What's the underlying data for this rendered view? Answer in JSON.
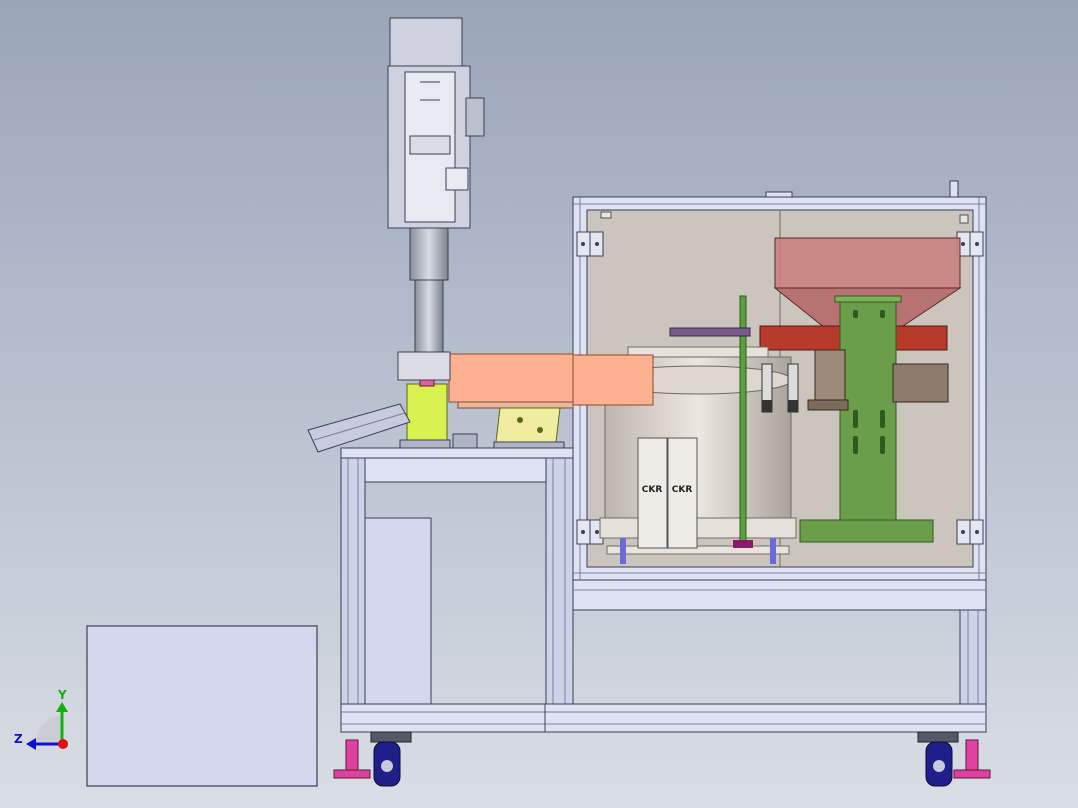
{
  "triad": {
    "y_label": "Y",
    "z_label": "Z",
    "colors": {
      "x": "#e01010",
      "y": "#10b010",
      "z": "#1010d0"
    }
  },
  "part_labels": {
    "left": "CKR",
    "right": "CKR"
  },
  "colors": {
    "background_top": "#9aa5b8",
    "background_bottom": "#d9dde5",
    "frame": "#cdd2e8",
    "frame_edge": "#3a3f55",
    "glass": "#cbc5bd",
    "hopper": "#c98080",
    "conveyor": "#ffb090",
    "feeder_block": "#d8f050",
    "green_support": "#6a9e4a",
    "red_rail": "#b83a2a",
    "bracket": "#8c7a6a",
    "caster": "#1f1f8c",
    "leveling_foot": "#e040a0"
  }
}
